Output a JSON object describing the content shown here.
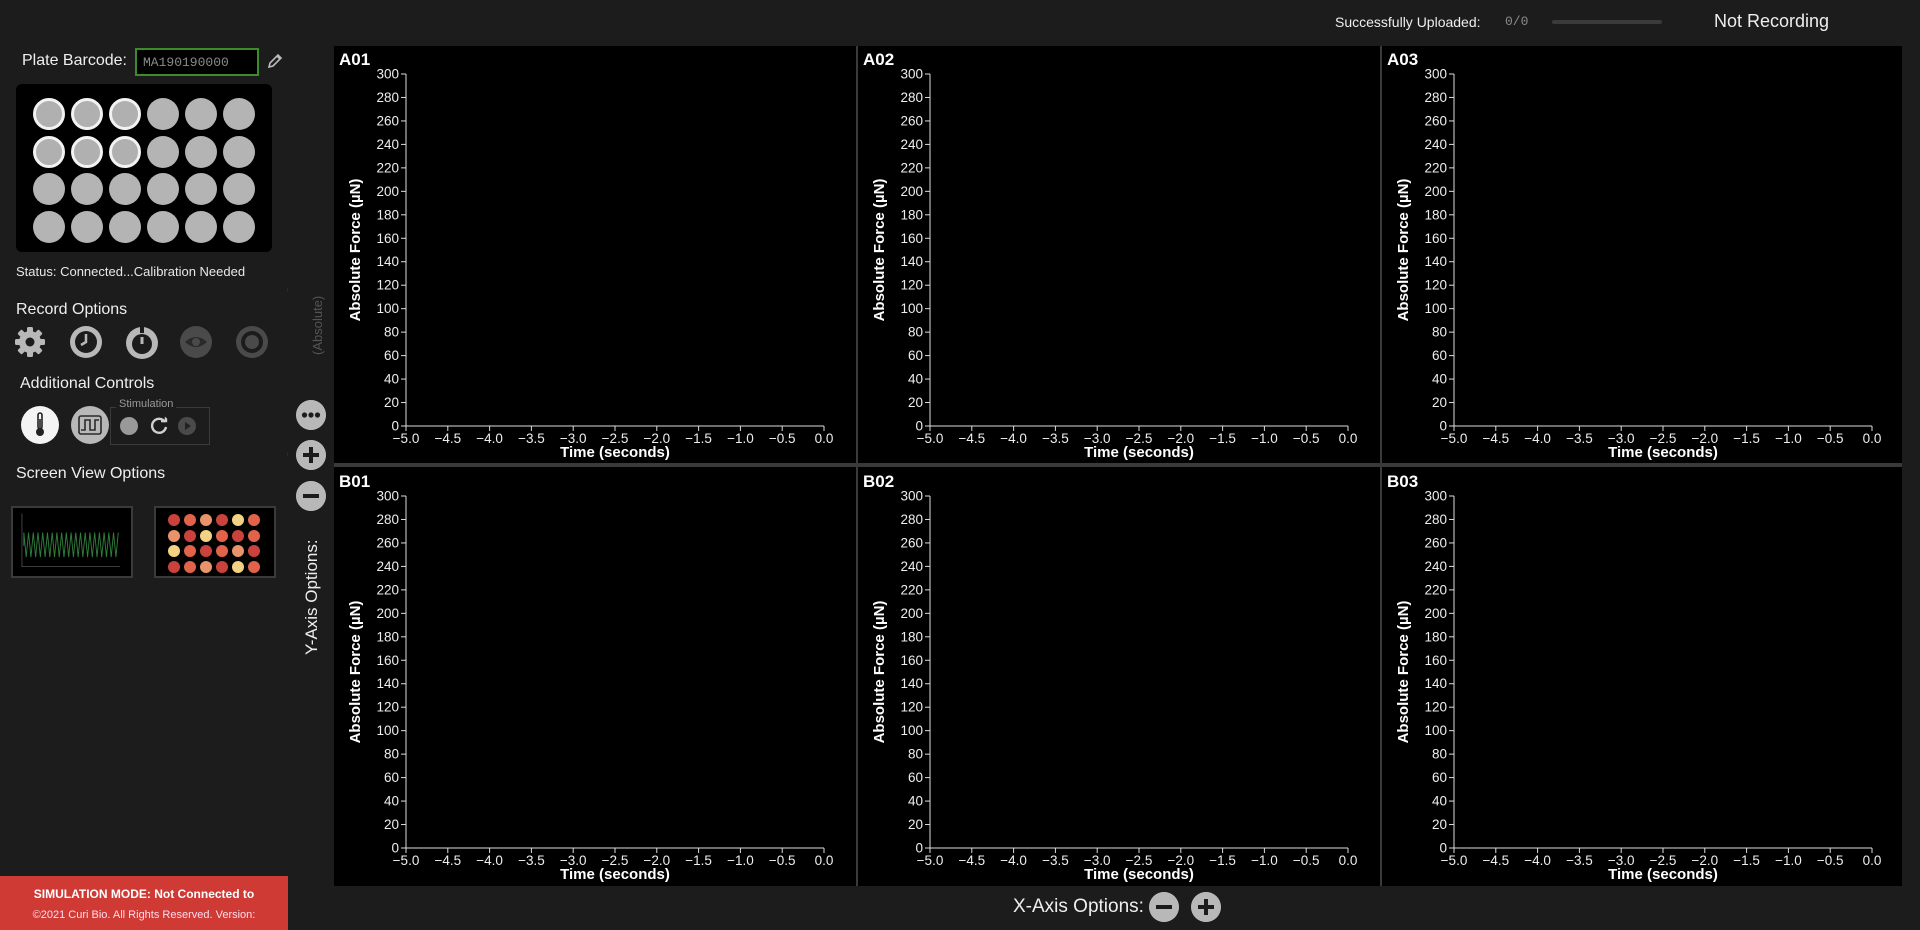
{
  "plate": {
    "barcode_label": "Plate Barcode:",
    "barcode_value": "MA190190000",
    "status": "Status: Connected...Calibration Needed",
    "selected_wells": [
      "A1",
      "A2",
      "A3",
      "B1",
      "B2",
      "B3"
    ]
  },
  "record": {
    "title": "Record Options",
    "icons": [
      "gear-icon",
      "clock-icon",
      "timer-icon",
      "eye-icon",
      "record-icon"
    ]
  },
  "additional": {
    "title": "Additional Controls",
    "stimulation_label": "Stimulation"
  },
  "screen_view": {
    "title": "Screen View Options"
  },
  "footer": {
    "sim_line": "SIMULATION MODE: Not Connected to",
    "copyright": "©2021 Curi Bio. All Rights Reserved. Version:"
  },
  "topbar": {
    "upload_label": "Successfully Uploaded:",
    "upload_count": "0/0",
    "upload_progress": 0,
    "recording_status": "Not Recording"
  },
  "y_axis_options": {
    "title": "Y-Axis Options:",
    "mode": "(Absolute)"
  },
  "x_axis_options": {
    "title": "X-Axis Options:"
  },
  "chart_data": [
    {
      "type": "line",
      "title": "A01",
      "xlabel": "Time (seconds)",
      "ylabel": "Absolute Force (µN)",
      "xlim": [
        -5.0,
        0.0
      ],
      "ylim": [
        0,
        300
      ],
      "series": []
    },
    {
      "type": "line",
      "title": "A02",
      "xlabel": "Time (seconds)",
      "ylabel": "Absolute Force (µN)",
      "xlim": [
        -5.0,
        0.0
      ],
      "ylim": [
        0,
        300
      ],
      "series": []
    },
    {
      "type": "line",
      "title": "A03",
      "xlabel": "Time (seconds)",
      "ylabel": "Absolute Force (µN)",
      "xlim": [
        -5.0,
        0.0
      ],
      "ylim": [
        0,
        300
      ],
      "series": []
    },
    {
      "type": "line",
      "title": "B01",
      "xlabel": "Time (seconds)",
      "ylabel": "Absolute Force (µN)",
      "xlim": [
        -5.0,
        0.0
      ],
      "ylim": [
        0,
        300
      ],
      "series": []
    },
    {
      "type": "line",
      "title": "B02",
      "xlabel": "Time (seconds)",
      "ylabel": "Absolute Force (µN)",
      "xlim": [
        -5.0,
        0.0
      ],
      "ylim": [
        0,
        300
      ],
      "series": []
    },
    {
      "type": "line",
      "title": "B03",
      "xlabel": "Time (seconds)",
      "ylabel": "Absolute Force (µN)",
      "xlim": [
        -5.0,
        0.0
      ],
      "ylim": [
        0,
        300
      ],
      "series": []
    }
  ],
  "axis_ticks": {
    "x": [
      "−5.0",
      "−4.5",
      "−4.0",
      "−3.5",
      "−3.0",
      "−2.5",
      "−2.0",
      "−1.5",
      "−1.0",
      "−0.5",
      "0.0"
    ],
    "y": [
      "0",
      "20",
      "40",
      "60",
      "80",
      "100",
      "120",
      "140",
      "160",
      "180",
      "200",
      "220",
      "240",
      "260",
      "280",
      "300"
    ]
  }
}
